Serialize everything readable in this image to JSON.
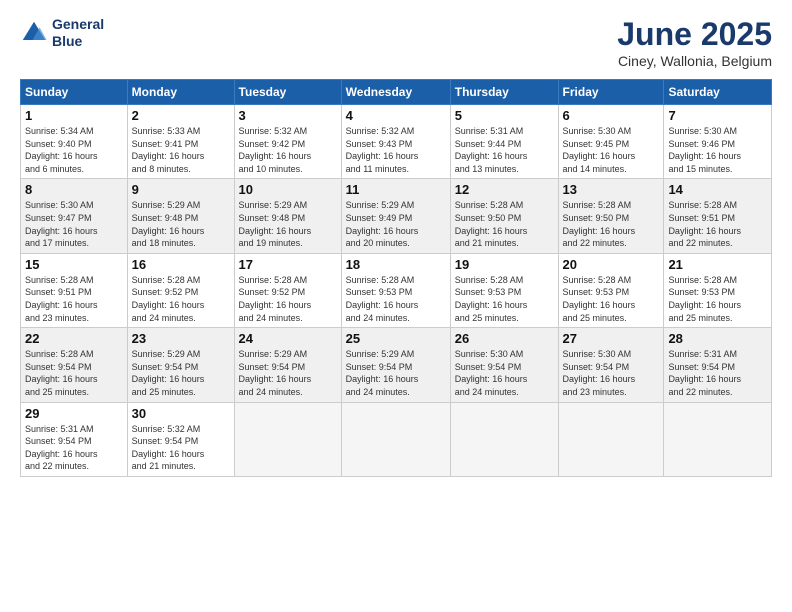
{
  "logo": {
    "line1": "General",
    "line2": "Blue"
  },
  "title": "June 2025",
  "location": "Ciney, Wallonia, Belgium",
  "weekdays": [
    "Sunday",
    "Monday",
    "Tuesday",
    "Wednesday",
    "Thursday",
    "Friday",
    "Saturday"
  ],
  "weeks": [
    [
      {
        "day": 1,
        "sunrise": "5:34 AM",
        "sunset": "9:40 PM",
        "daylight": "16 hours and 6 minutes."
      },
      {
        "day": 2,
        "sunrise": "5:33 AM",
        "sunset": "9:41 PM",
        "daylight": "16 hours and 8 minutes."
      },
      {
        "day": 3,
        "sunrise": "5:32 AM",
        "sunset": "9:42 PM",
        "daylight": "16 hours and 10 minutes."
      },
      {
        "day": 4,
        "sunrise": "5:32 AM",
        "sunset": "9:43 PM",
        "daylight": "16 hours and 11 minutes."
      },
      {
        "day": 5,
        "sunrise": "5:31 AM",
        "sunset": "9:44 PM",
        "daylight": "16 hours and 13 minutes."
      },
      {
        "day": 6,
        "sunrise": "5:30 AM",
        "sunset": "9:45 PM",
        "daylight": "16 hours and 14 minutes."
      },
      {
        "day": 7,
        "sunrise": "5:30 AM",
        "sunset": "9:46 PM",
        "daylight": "16 hours and 15 minutes."
      }
    ],
    [
      {
        "day": 8,
        "sunrise": "5:30 AM",
        "sunset": "9:47 PM",
        "daylight": "16 hours and 17 minutes."
      },
      {
        "day": 9,
        "sunrise": "5:29 AM",
        "sunset": "9:48 PM",
        "daylight": "16 hours and 18 minutes."
      },
      {
        "day": 10,
        "sunrise": "5:29 AM",
        "sunset": "9:48 PM",
        "daylight": "16 hours and 19 minutes."
      },
      {
        "day": 11,
        "sunrise": "5:29 AM",
        "sunset": "9:49 PM",
        "daylight": "16 hours and 20 minutes."
      },
      {
        "day": 12,
        "sunrise": "5:28 AM",
        "sunset": "9:50 PM",
        "daylight": "16 hours and 21 minutes."
      },
      {
        "day": 13,
        "sunrise": "5:28 AM",
        "sunset": "9:50 PM",
        "daylight": "16 hours and 22 minutes."
      },
      {
        "day": 14,
        "sunrise": "5:28 AM",
        "sunset": "9:51 PM",
        "daylight": "16 hours and 22 minutes."
      }
    ],
    [
      {
        "day": 15,
        "sunrise": "5:28 AM",
        "sunset": "9:51 PM",
        "daylight": "16 hours and 23 minutes."
      },
      {
        "day": 16,
        "sunrise": "5:28 AM",
        "sunset": "9:52 PM",
        "daylight": "16 hours and 24 minutes."
      },
      {
        "day": 17,
        "sunrise": "5:28 AM",
        "sunset": "9:52 PM",
        "daylight": "16 hours and 24 minutes."
      },
      {
        "day": 18,
        "sunrise": "5:28 AM",
        "sunset": "9:53 PM",
        "daylight": "16 hours and 24 minutes."
      },
      {
        "day": 19,
        "sunrise": "5:28 AM",
        "sunset": "9:53 PM",
        "daylight": "16 hours and 25 minutes."
      },
      {
        "day": 20,
        "sunrise": "5:28 AM",
        "sunset": "9:53 PM",
        "daylight": "16 hours and 25 minutes."
      },
      {
        "day": 21,
        "sunrise": "5:28 AM",
        "sunset": "9:53 PM",
        "daylight": "16 hours and 25 minutes."
      }
    ],
    [
      {
        "day": 22,
        "sunrise": "5:28 AM",
        "sunset": "9:54 PM",
        "daylight": "16 hours and 25 minutes."
      },
      {
        "day": 23,
        "sunrise": "5:29 AM",
        "sunset": "9:54 PM",
        "daylight": "16 hours and 25 minutes."
      },
      {
        "day": 24,
        "sunrise": "5:29 AM",
        "sunset": "9:54 PM",
        "daylight": "16 hours and 24 minutes."
      },
      {
        "day": 25,
        "sunrise": "5:29 AM",
        "sunset": "9:54 PM",
        "daylight": "16 hours and 24 minutes."
      },
      {
        "day": 26,
        "sunrise": "5:30 AM",
        "sunset": "9:54 PM",
        "daylight": "16 hours and 24 minutes."
      },
      {
        "day": 27,
        "sunrise": "5:30 AM",
        "sunset": "9:54 PM",
        "daylight": "16 hours and 23 minutes."
      },
      {
        "day": 28,
        "sunrise": "5:31 AM",
        "sunset": "9:54 PM",
        "daylight": "16 hours and 22 minutes."
      }
    ],
    [
      {
        "day": 29,
        "sunrise": "5:31 AM",
        "sunset": "9:54 PM",
        "daylight": "16 hours and 22 minutes."
      },
      {
        "day": 30,
        "sunrise": "5:32 AM",
        "sunset": "9:54 PM",
        "daylight": "16 hours and 21 minutes."
      },
      null,
      null,
      null,
      null,
      null
    ]
  ],
  "labels": {
    "sunrise": "Sunrise:",
    "sunset": "Sunset:",
    "daylight": "Daylight:"
  }
}
